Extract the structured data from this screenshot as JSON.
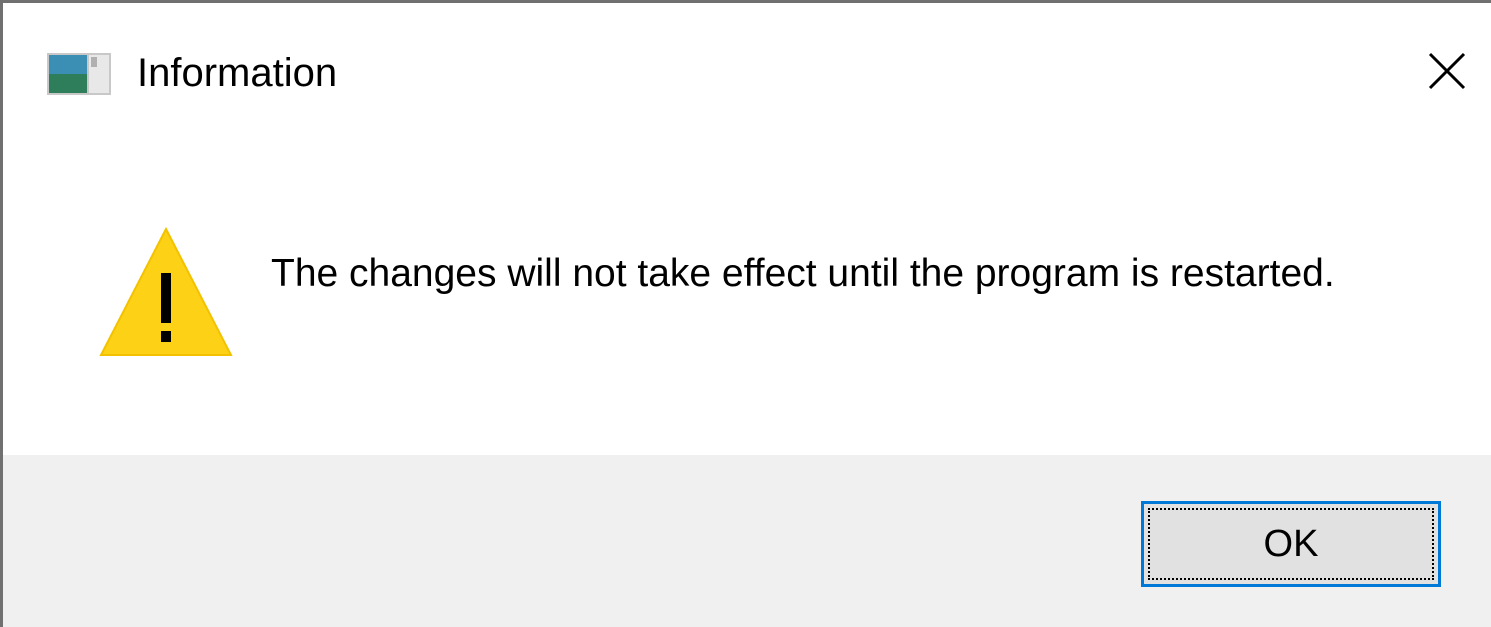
{
  "window": {
    "title": "Information",
    "icon": "app-window-icon",
    "close_icon": "close-icon"
  },
  "message": {
    "icon": "warning-icon",
    "text": "The changes will not take effect until the program is restarted."
  },
  "buttons": {
    "ok_label": "OK"
  },
  "colors": {
    "warning_fill": "#fcd116",
    "focus_border": "#0078d7",
    "footer_bg": "#f0f0f0"
  }
}
